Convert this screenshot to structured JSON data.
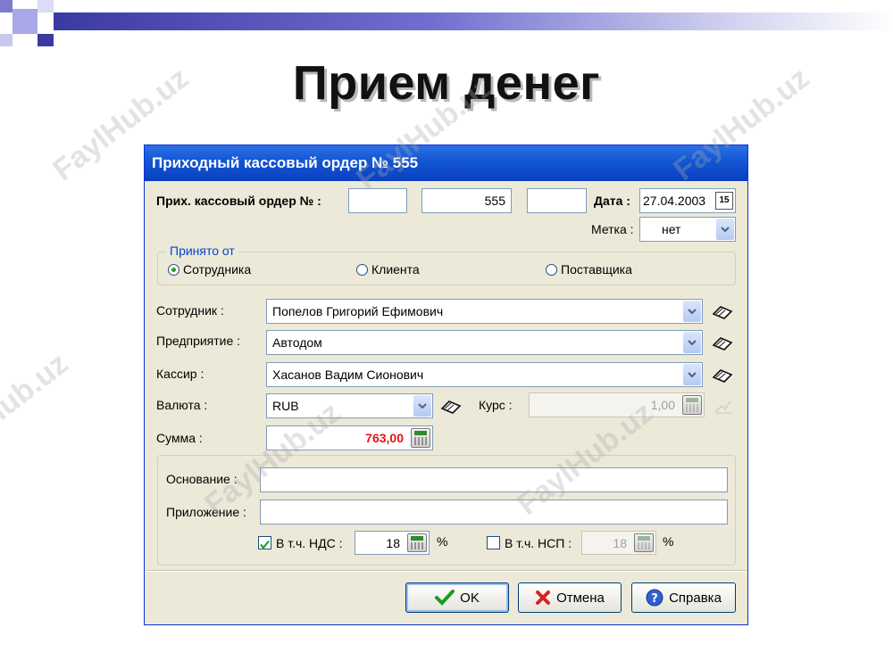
{
  "slide": {
    "title": "Прием денег",
    "watermark": "FaylHub.uz"
  },
  "dialog": {
    "title": "Приходный кассовый ордер № 555",
    "order_label": "Прих. кассовый ордер № :",
    "order_prefix": "",
    "order_number": "555",
    "order_suffix": "",
    "date_label": "Дата :",
    "date_value": "27.04.2003",
    "tag_label": "Метка :",
    "tag_value": "нет",
    "received_from": {
      "legend": "Принято от",
      "options": [
        "Сотрудника",
        "Клиента",
        "Поставщика"
      ],
      "selected": "Сотрудника"
    },
    "employee_label": "Сотрудник :",
    "employee_value": "Попелов Григорий Ефимович",
    "company_label": "Предприятие :",
    "company_value": "Автодом",
    "cashier_label": "Кассир :",
    "cashier_value": "Хасанов Вадим Сионович",
    "currency_label": "Валюта :",
    "currency_value": "RUB",
    "rate_label": "Курс :",
    "rate_value": "1,00",
    "amount_label": "Сумма :",
    "amount_value": "763,00",
    "basis_label": "Основание :",
    "basis_value": "",
    "attachment_label": "Приложение :",
    "attachment_value": "",
    "vat_label": "В т.ч. НДС :",
    "vat_checked": true,
    "vat_value": "18",
    "vat_unit": "%",
    "nsp_label": "В т.ч. НСП :",
    "nsp_checked": false,
    "nsp_value": "18",
    "nsp_unit": "%",
    "buttons": {
      "ok": "OK",
      "cancel": "Отмена",
      "help": "Справка"
    }
  },
  "colors": {
    "amount": "#e8101a",
    "titlebar": "#0a3fc0",
    "dialog_bg": "#ece9d8"
  }
}
